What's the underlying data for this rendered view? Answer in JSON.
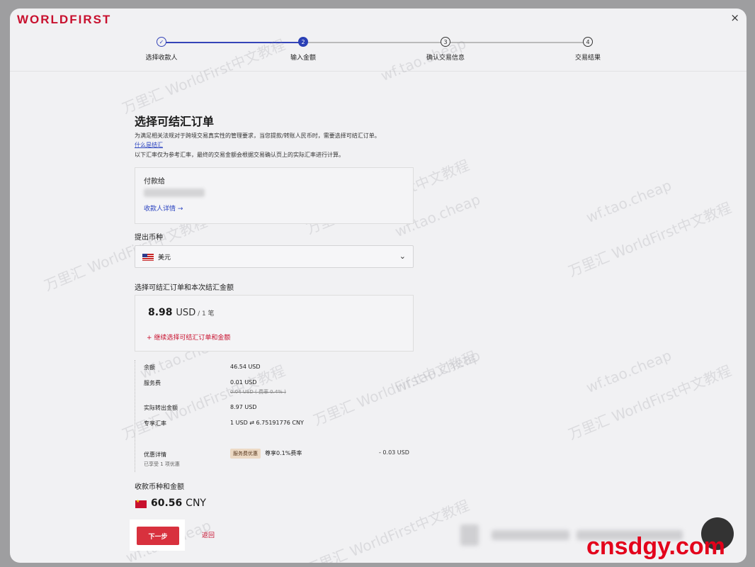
{
  "app": {
    "logo": "WORLDFIRST",
    "close": "×"
  },
  "steps": [
    {
      "num": "✓",
      "label": "选择收款人",
      "state": "done"
    },
    {
      "num": "2",
      "label": "输入金额",
      "state": "active"
    },
    {
      "num": "3",
      "label": "确认交易信息",
      "state": "pending"
    },
    {
      "num": "4",
      "label": "交易结果",
      "state": "pending"
    }
  ],
  "colors": {
    "brand": "#c8102e",
    "primary": "#2a3fb5",
    "button": "#d8313e"
  },
  "page": {
    "title": "选择可结汇订单",
    "desc1": "为满足相关法规对于跨境交易真实性的管理要求，当您提款/转账人民币时，需要选择可结汇订单。",
    "what_link": "什么是结汇",
    "desc2": "以下汇率仅为参考汇率，最终的交易金额会根据交易确认页上的实际汇率进行计算。"
  },
  "payee": {
    "label": "付款给",
    "details_link": "收款人详情 →"
  },
  "currency": {
    "label": "提出币种",
    "selected": "美元",
    "flag_icon": "us-flag-icon"
  },
  "orders": {
    "label": "选择可结汇订单和本次结汇金额",
    "amount": "8.98",
    "unit": "USD",
    "count": " / 1 笔",
    "add_link": "+ 继续选择可结汇订单和金额"
  },
  "summary": {
    "balance_label": "余额",
    "balance": "46.54 USD",
    "fee_label": "服务费",
    "fee": "0.01 USD",
    "fee_original": "0.04 USD ( 费率 0.4% )",
    "actual_label": "实际转出金额",
    "actual": "8.97 USD",
    "rate_label": "专享汇率",
    "rate": "1 USD ⇄ 6.75191776 CNY",
    "discount_label": "优惠详情",
    "discount_badge": "服务费优惠",
    "discount_desc": "尊享0.1%费率",
    "discount_amount": "- 0.03 USD",
    "applied": "已享受 1 项优惠"
  },
  "receive": {
    "label": "收款币种和金额",
    "amount": "60.56",
    "unit": "CNY"
  },
  "actions": {
    "next": "下一步",
    "back": "返回"
  },
  "watermark": {
    "text": "万里汇 WorldFirst中文教程",
    "site": "wf.tao.cheap"
  },
  "brand_stamp": "cnsdgy.com"
}
